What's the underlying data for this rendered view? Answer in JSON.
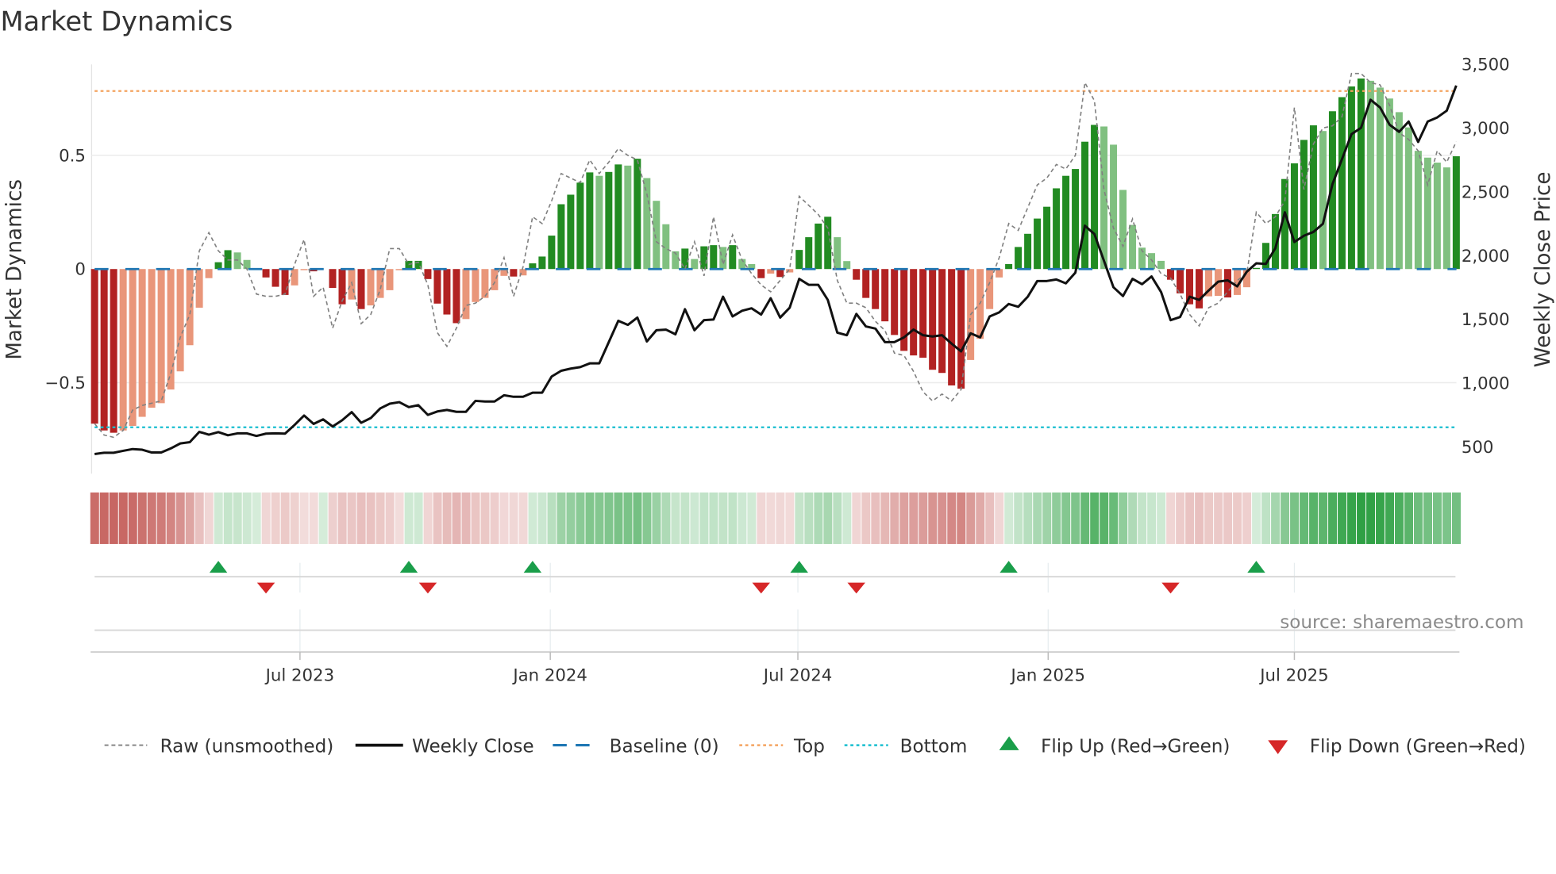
{
  "chart_data": {
    "type": "bar",
    "title": "Market Dynamics",
    "ylabel_left": "Market Dynamics",
    "ylabel_right": "Weekly Close Price",
    "source": "source: sharemaestro.com",
    "x_start": "2023-01-31",
    "x_step_days": 7,
    "x_ticks": [
      {
        "date": "2023-07-01",
        "label": "Jul 2023"
      },
      {
        "date": "2024-01-01",
        "label": "Jan 2024"
      },
      {
        "date": "2024-07-01",
        "label": "Jul 2024"
      },
      {
        "date": "2025-01-01",
        "label": "Jan 2025"
      },
      {
        "date": "2025-07-01",
        "label": "Jul 2025"
      }
    ],
    "ylim_left": [
      -0.9,
      0.9
    ],
    "yticks_left": [
      {
        "v": 0.5,
        "label": "0.5"
      },
      {
        "v": 0,
        "label": "0"
      },
      {
        "v": -0.5,
        "label": "−0.5"
      }
    ],
    "ylim_right": [
      290,
      3500
    ],
    "yticks_right": [
      {
        "v": 3500,
        "label": "3,500"
      },
      {
        "v": 3000,
        "label": "3,000"
      },
      {
        "v": 2500,
        "label": "2,500"
      },
      {
        "v": 2000,
        "label": "2,000"
      },
      {
        "v": 1500,
        "label": "1,500"
      },
      {
        "v": 1000,
        "label": "1,000"
      },
      {
        "v": 500,
        "label": "500"
      }
    ],
    "top_level": 0.783,
    "bottom_level": -0.696,
    "baseline": 0,
    "colors": {
      "up_strong": "#228b22",
      "up_weak": "#80c080",
      "down_strong": "#b22222",
      "down_weak": "#e9967a",
      "raw": "#808080",
      "close": "#111111",
      "baseline": "#1f77b4",
      "top": "#f4a460",
      "bottom": "#17becf",
      "flip_up": "#1a9e4a",
      "flip_down": "#d62728"
    },
    "series": [
      {
        "name": "Market Dynamics (smoothed)",
        "values": [
          -0.68,
          -0.71,
          -0.72,
          -0.71,
          -0.69,
          -0.65,
          -0.61,
          -0.59,
          -0.53,
          -0.45,
          -0.335,
          -0.17,
          -0.04,
          0.03,
          0.083,
          0.073,
          0.04,
          0.0,
          -0.037,
          -0.078,
          -0.114,
          -0.072,
          -0.005,
          -0.01,
          0.0,
          -0.083,
          -0.155,
          -0.134,
          -0.176,
          -0.16,
          -0.127,
          -0.093,
          -0.005,
          0.036,
          0.036,
          -0.044,
          -0.152,
          -0.2,
          -0.238,
          -0.22,
          -0.145,
          -0.127,
          -0.093,
          -0.03,
          -0.033,
          -0.028,
          0.025,
          0.055,
          0.147,
          0.285,
          0.327,
          0.38,
          0.425,
          0.41,
          0.427,
          0.46,
          0.455,
          0.485,
          0.4,
          0.3,
          0.197,
          0.078,
          0.09,
          0.044,
          0.1,
          0.105,
          0.097,
          0.105,
          0.044,
          0.022,
          -0.04,
          -0.02,
          -0.035,
          -0.015,
          0.084,
          0.14,
          0.2,
          0.23,
          0.14,
          0.035,
          -0.047,
          -0.127,
          -0.176,
          -0.23,
          -0.29,
          -0.36,
          -0.38,
          -0.39,
          -0.443,
          -0.457,
          -0.512,
          -0.526,
          -0.4,
          -0.307,
          -0.176,
          -0.037,
          0.022,
          0.097,
          0.155,
          0.222,
          0.274,
          0.355,
          0.41,
          0.44,
          0.56,
          0.634,
          0.627,
          0.547,
          0.348,
          0.194,
          0.094,
          0.07,
          0.036,
          -0.047,
          -0.107,
          -0.155,
          -0.173,
          -0.12,
          -0.118,
          -0.125,
          -0.114,
          -0.08,
          0.005,
          0.115,
          0.242,
          0.396,
          0.465,
          0.568,
          0.632,
          0.607,
          0.694,
          0.756,
          0.803,
          0.838,
          0.828,
          0.798,
          0.75,
          0.69,
          0.623,
          0.52,
          0.49,
          0.468,
          0.447,
          0.496
        ]
      },
      {
        "name": "Raw (unsmoothed)",
        "values": [
          -0.68,
          -0.73,
          -0.74,
          -0.71,
          -0.62,
          -0.6,
          -0.59,
          -0.58,
          -0.46,
          -0.3,
          -0.2,
          0.08,
          0.16,
          0.08,
          0.04,
          0.04,
          0.0,
          -0.11,
          -0.12,
          -0.12,
          -0.11,
          0.02,
          0.13,
          -0.12,
          -0.08,
          -0.26,
          -0.14,
          -0.06,
          -0.24,
          -0.2,
          -0.09,
          0.09,
          0.09,
          0.02,
          0.03,
          -0.07,
          -0.28,
          -0.34,
          -0.26,
          -0.16,
          -0.15,
          -0.12,
          -0.06,
          0.05,
          -0.12,
          0.01,
          0.23,
          0.2,
          0.3,
          0.42,
          0.4,
          0.38,
          0.48,
          0.42,
          0.47,
          0.53,
          0.5,
          0.48,
          0.33,
          0.12,
          0.09,
          0.07,
          0.0,
          0.12,
          -0.03,
          0.23,
          0.02,
          0.15,
          0.04,
          -0.02,
          -0.07,
          -0.1,
          -0.05,
          0.0,
          0.32,
          0.28,
          0.24,
          0.18,
          -0.05,
          -0.15,
          -0.15,
          -0.17,
          -0.23,
          -0.27,
          -0.37,
          -0.38,
          -0.45,
          -0.54,
          -0.58,
          -0.55,
          -0.58,
          -0.53,
          -0.2,
          -0.15,
          -0.06,
          0.05,
          0.2,
          0.17,
          0.27,
          0.37,
          0.4,
          0.46,
          0.44,
          0.5,
          0.82,
          0.74,
          0.35,
          0.18,
          0.1,
          0.22,
          0.08,
          0.04,
          -0.02,
          -0.04,
          -0.11,
          -0.2,
          -0.25,
          -0.17,
          -0.15,
          -0.1,
          -0.05,
          -0.02,
          0.25,
          0.2,
          0.23,
          0.3,
          0.71,
          0.35,
          0.55,
          0.62,
          0.63,
          0.67,
          0.86,
          0.86,
          0.82,
          0.81,
          0.72,
          0.6,
          0.57,
          0.52,
          0.37,
          0.52,
          0.47,
          0.56
        ]
      },
      {
        "name": "Weekly Close",
        "axis": "right",
        "values": [
          444,
          454,
          454,
          469,
          483,
          478,
          456,
          456,
          488,
          527,
          537,
          618,
          596,
          616,
          591,
          606,
          606,
          586,
          604,
          606,
          604,
          672,
          746,
          680,
          716,
          660,
          709,
          773,
          689,
          726,
          802,
          839,
          851,
          812,
          827,
          751,
          778,
          790,
          775,
          775,
          861,
          856,
          856,
          905,
          893,
          893,
          925,
          925,
          1052,
          1097,
          1114,
          1126,
          1155,
          1155,
          1322,
          1489,
          1457,
          1514,
          1327,
          1415,
          1420,
          1383,
          1580,
          1415,
          1494,
          1499,
          1678,
          1523,
          1568,
          1587,
          1538,
          1666,
          1514,
          1592,
          1818,
          1771,
          1771,
          1653,
          1396,
          1376,
          1543,
          1445,
          1428,
          1322,
          1322,
          1359,
          1420,
          1376,
          1366,
          1376,
          1310,
          1249,
          1391,
          1359,
          1523,
          1555,
          1621,
          1599,
          1678,
          1801,
          1801,
          1813,
          1783,
          1867,
          2235,
          2169,
          1960,
          1752,
          1683,
          1818,
          1776,
          1837,
          1715,
          1494,
          1519,
          1678,
          1653,
          1727,
          1796,
          1806,
          1759,
          1874,
          1940,
          1935,
          2058,
          2340,
          2107,
          2156,
          2186,
          2250,
          2561,
          2757,
          2953,
          3003,
          3223,
          3162,
          3027,
          2971,
          3052,
          2892,
          3052,
          3084,
          3137,
          3334
        ]
      }
    ],
    "flip_up_weeks": [
      13,
      33,
      46,
      74,
      96,
      122
    ],
    "flip_down_weeks": [
      18,
      35,
      70,
      80,
      113
    ],
    "legend": {
      "placement": "bottom",
      "items": [
        "Raw (unsmoothed)",
        "Weekly Close",
        "Baseline (0)",
        "Top",
        "Bottom",
        "Flip Up (Red→Green)",
        "Flip Down (Green→Red)"
      ]
    }
  }
}
